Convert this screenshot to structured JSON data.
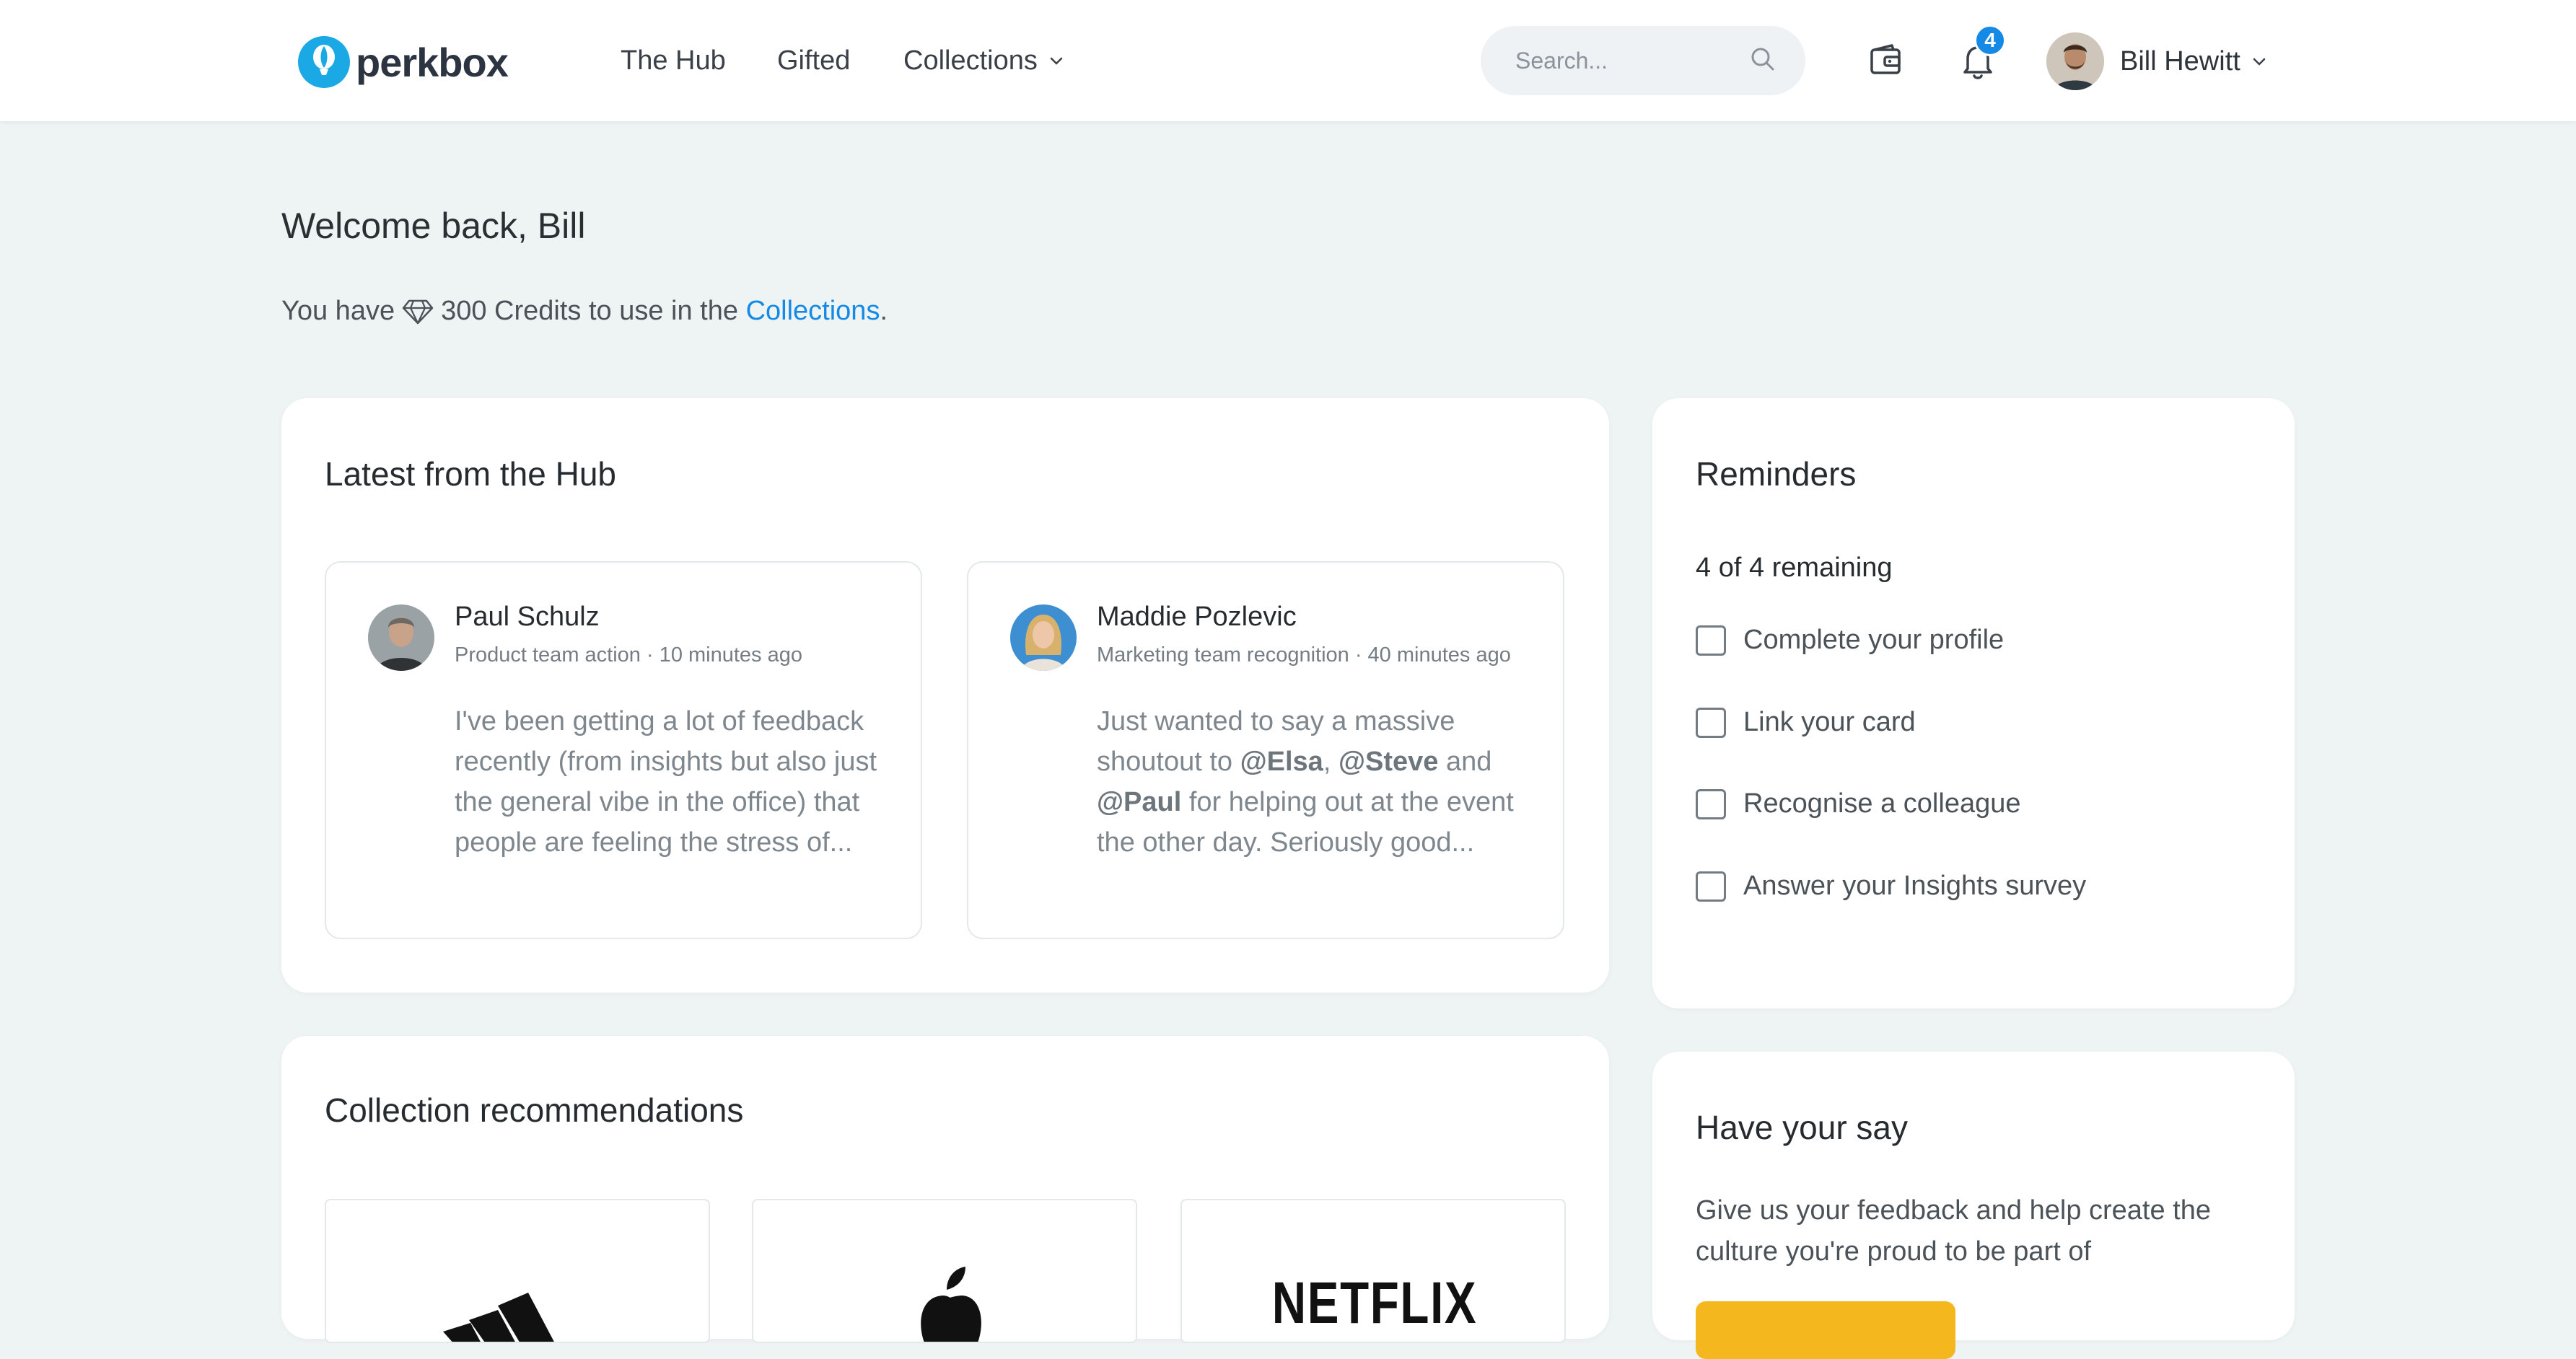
{
  "header": {
    "logo_text": "perkbox",
    "nav": [
      {
        "label": "The Hub"
      },
      {
        "label": "Gifted"
      },
      {
        "label": "Collections"
      }
    ],
    "search": {
      "placeholder": "Search..."
    },
    "notifications_count": "4",
    "user_name": "Bill Hewitt",
    "icons": {
      "search": "search-icon",
      "wallet": "wallet-icon",
      "bell": "bell-icon",
      "chevron": "chevron-down-icon"
    }
  },
  "welcome": {
    "title": "Welcome back, Bill",
    "credits_prefix": "You have",
    "credits_amount": "300 Credits to use in the ",
    "credits_link": "Collections",
    "credits_suffix": "."
  },
  "hub": {
    "title": "Latest from the Hub",
    "posts": [
      {
        "author": "Paul Schulz",
        "meta": "Product team action · 10 minutes ago",
        "body": "I've been getting a lot of feedback recently (from insights but also just the general vibe in the office) that people are feeling the stress of..."
      },
      {
        "author": "Maddie Pozlevic",
        "meta": "Marketing team recognition · 40 minutes ago",
        "body_parts": [
          "Just wanted to say a massive shoutout to ",
          "@Elsa",
          ", ",
          "@Steve",
          " and ",
          "@Paul",
          " for helping out at the event the other day. Seriously good..."
        ]
      }
    ]
  },
  "reminders": {
    "title": "Reminders",
    "count_text": "4 of 4 remaining",
    "items": [
      {
        "label": "Complete your profile",
        "checked": false
      },
      {
        "label": "Link your card",
        "checked": false
      },
      {
        "label": "Recognise a colleague",
        "checked": false
      },
      {
        "label": "Answer your Insights survey",
        "checked": false
      }
    ]
  },
  "collections": {
    "title": "Collection recommendations",
    "brands": [
      {
        "name": "adidas-logo"
      },
      {
        "name": "apple-logo"
      },
      {
        "name": "netflix-logo",
        "text": "NETFLIX"
      }
    ]
  },
  "say": {
    "title": "Have your say",
    "text": "Give us your feedback and help create the culture you're proud to be part of"
  },
  "colors": {
    "accent": "#1589e6",
    "logo": "#1ba9e6",
    "background": "#eef3f4",
    "button_yellow": "#f5b71e",
    "netflix_text": "#111111"
  }
}
